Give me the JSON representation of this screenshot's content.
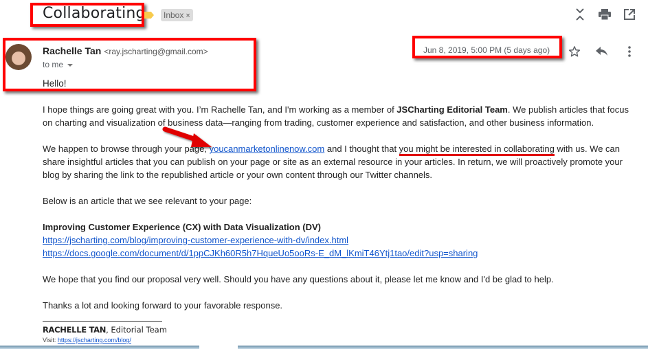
{
  "subject": {
    "title": "Collaborating",
    "label_chip": "Inbox",
    "label_chip_close": "×"
  },
  "toolbar": {
    "icons": [
      "expand-collapse-all-icon",
      "print-icon",
      "open-in-new-window-icon"
    ]
  },
  "message": {
    "sender_name": "Rachelle Tan",
    "sender_email": "<ray.jscharting@gmail.com>",
    "recipient": "to me",
    "date": "Jun 8, 2019, 5:00 PM (5 days ago)",
    "actions": [
      "star-icon",
      "reply-icon",
      "more-options-icon"
    ],
    "greeting": "Hello!"
  },
  "body": {
    "p1_a": "I hope things are going great with you. I’m Rachelle Tan, and I'm working as a member of ",
    "p1_bold": "JSCharting Editorial Team",
    "p1_b": ". We publish articles that focus on charting and visualization of business data—ranging from trading, customer experience and satisfaction, and other business information.",
    "p2_a": "We happen to browse through your page, ",
    "p2_link": "youcanmarketonlinenow.com",
    "p2_b": " and I thought that ",
    "p2_highlight": "you might be interested in collaborating",
    "p2_c": " with us. We can share insightful articles that you can publish on your page or site as an external resource in your articles. In return, we will proactively promote your blog by sharing the link to the republished article or your own content through our Twitter channels.",
    "p3": "Below is an article that we see relevant to your page:",
    "article_title": "Improving Customer Experience (CX) with Data Visualization (DV)",
    "article_link_1": "https://jscharting.com/blog/improving-customer-experience-with-dv/index.html",
    "article_link_2": "https://docs.google.com/document/d/1ppCJKh60R5h7HqueUo5ooRs-E_dM_lKmiT46Ytj1tao/edit?usp=sharing",
    "p4": "We hope that you find our proposal very well. Should you have any questions about it, please let me know and I'd be glad to help.",
    "p5": "Thanks a lot and looking forward to your favorable response."
  },
  "signature": {
    "name": "RACHELLE TAN",
    "role": ", Editorial Team",
    "visit_label": "Visit: ",
    "visit_link": "https://jscharting.com/blog/"
  },
  "annotation_colors": {
    "box": "#ff0000",
    "underline": "#e00000",
    "arrow": "#e00000"
  }
}
